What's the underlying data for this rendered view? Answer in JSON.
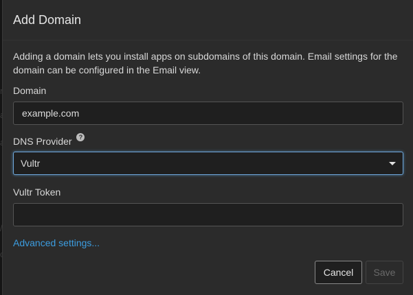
{
  "dialog": {
    "title": "Add Domain",
    "intro": "Adding a domain lets you install apps on subdomains of this domain. Email settings for the domain can be configured in the Email view."
  },
  "form": {
    "domain_label": "Domain",
    "domain_value": "example.com",
    "dns_provider_label": "DNS Provider",
    "help_icon": "?",
    "dns_provider_selected": "Vultr",
    "token_label": "Vultr Token",
    "token_value": "",
    "advanced_link": "Advanced settings..."
  },
  "buttons": {
    "cancel": "Cancel",
    "save": "Save"
  },
  "colors": {
    "link": "#3c9de0",
    "focus_border": "#6fa8dc",
    "modal_bg": "#2b2b2b"
  }
}
